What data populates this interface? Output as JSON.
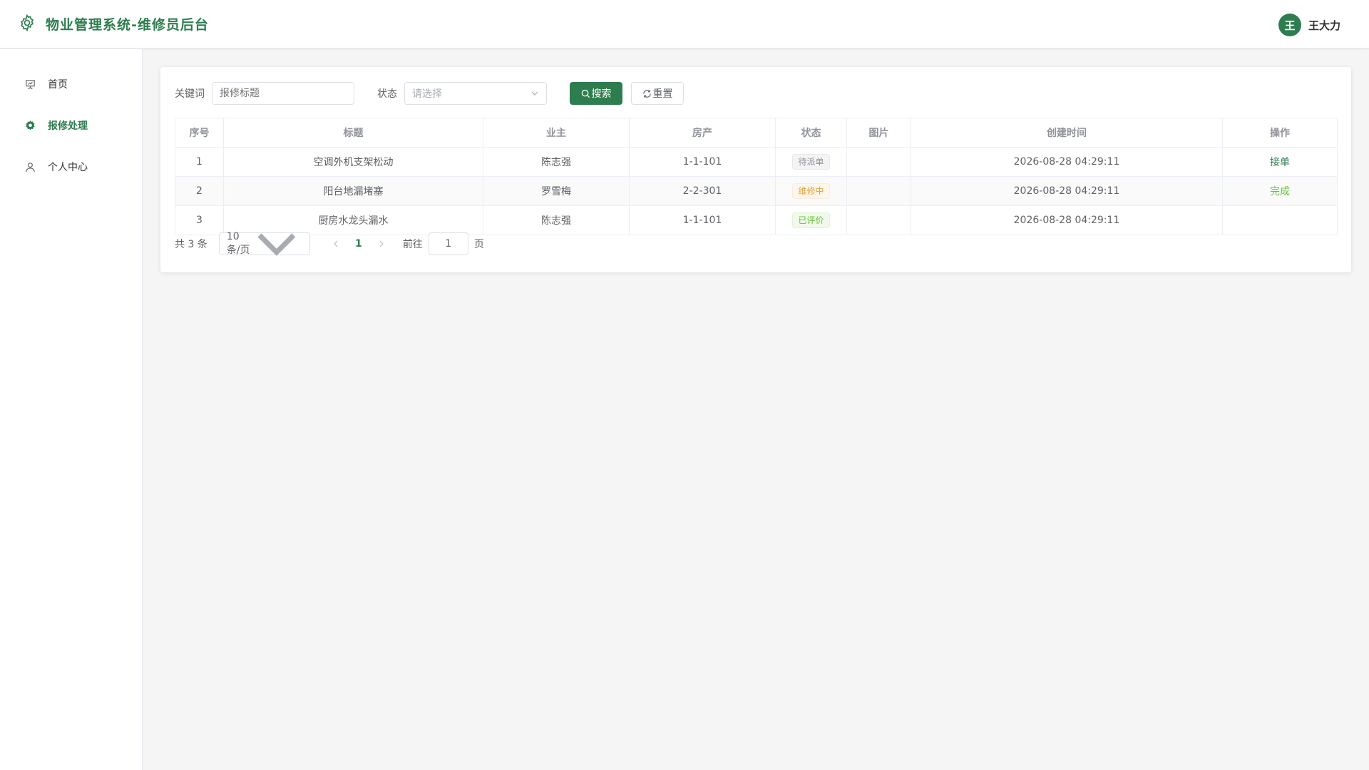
{
  "header": {
    "title": "物业管理系统-维修员后台",
    "icon": "gear-icon"
  },
  "user": {
    "avatar_text": "王",
    "name": "王大力"
  },
  "sidebar": {
    "items": [
      {
        "label": "首页",
        "icon": "presentation-icon",
        "active": false
      },
      {
        "label": "报修处理",
        "icon": "gear-icon",
        "active": true
      },
      {
        "label": "个人中心",
        "icon": "user-icon",
        "active": false
      }
    ]
  },
  "filter": {
    "keyword_label": "关键词",
    "keyword_placeholder": "报修标题",
    "keyword_value": "",
    "status_label": "状态",
    "status_placeholder": "请选择",
    "search_label": "搜索",
    "reset_label": "重置"
  },
  "table": {
    "columns": [
      "序号",
      "标题",
      "业主",
      "房产",
      "状态",
      "图片",
      "创建时间",
      "操作"
    ],
    "rows": [
      {
        "index": "1",
        "title": "空调外机支架松动",
        "owner": "陈志强",
        "property": "1-1-101",
        "status": "待派单",
        "status_type": "info",
        "image": "",
        "created": "2026-08-28 04:29:11",
        "action": "接单",
        "action_type": "primary"
      },
      {
        "index": "2",
        "title": "阳台地漏堵塞",
        "owner": "罗雪梅",
        "property": "2-2-301",
        "status": "维修中",
        "status_type": "warning",
        "image": "",
        "created": "2026-08-28 04:29:11",
        "action": "完成",
        "action_type": "success"
      },
      {
        "index": "3",
        "title": "厨房水龙头漏水",
        "owner": "陈志强",
        "property": "1-1-101",
        "status": "已评价",
        "status_type": "success",
        "image": "",
        "created": "2026-08-28 04:29:11",
        "action": "",
        "action_type": ""
      }
    ]
  },
  "pagination": {
    "total_text": "共 3 条",
    "page_size": "10条/页",
    "current_page": "1",
    "goto_label": "前往",
    "goto_value": "1",
    "goto_suffix": "页"
  },
  "colors": {
    "brand": "#2e7d4f",
    "warning": "#e6a23c",
    "success": "#67c23a",
    "info": "#909399"
  }
}
